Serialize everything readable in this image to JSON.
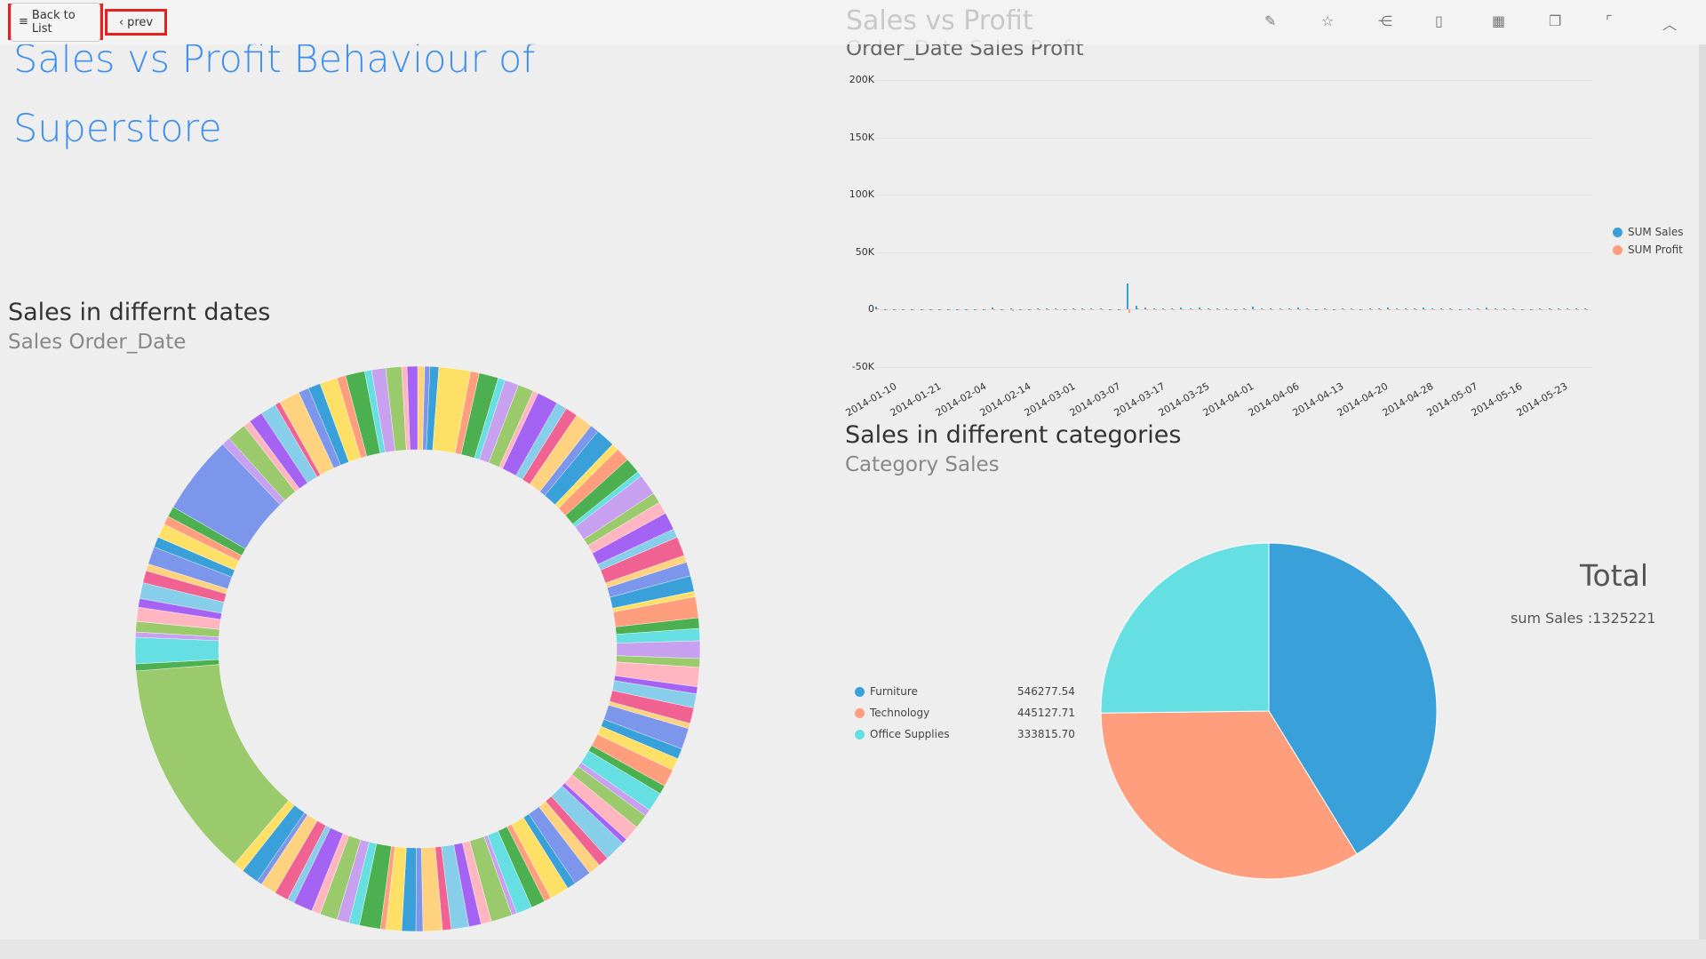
{
  "toolbar": {
    "back_label": "Back to List",
    "prev_label": "prev",
    "menu_icon": "list-icon",
    "prev_icon": "chevron-left-icon",
    "tools": [
      "edit-icon",
      "star-icon",
      "share-icon",
      "pdf-icon",
      "layout-filter-icon",
      "copy-icon",
      "fullscreen-icon",
      "chevron-up-icon"
    ]
  },
  "dashboard": {
    "title": "Sales vs Profit Behaviour of Superstore"
  },
  "colors": {
    "title": "#3d8fee",
    "sales": "#3aa0da",
    "profit": "#ff9e7d",
    "furniture": "#3aa0da",
    "technology": "#ff9e7d",
    "office": "#66dfe3"
  },
  "chart_data": [
    {
      "type": "bar",
      "title": "Sales vs Profit",
      "subtitle": "Order_Date Sales Profit",
      "yticks": [
        "200K",
        "150K",
        "100K",
        "50K",
        "0",
        "-50K"
      ],
      "ylim": [
        -50000,
        200000
      ],
      "xticks": [
        "2014-01-10",
        "2014-01-21",
        "2014-02-04",
        "2014-02-14",
        "2014-03-01",
        "2014-03-07",
        "2014-03-17",
        "2014-03-25",
        "2014-04-01",
        "2014-04-06",
        "2014-04-13",
        "2014-04-20",
        "2014-04-28",
        "2014-05-07",
        "2014-05-16",
        "2014-05-23"
      ],
      "legend": "right",
      "series": [
        {
          "name": "SUM Sales",
          "values": [
            2800,
            300,
            200,
            200,
            150,
            100,
            200,
            300,
            400,
            300,
            200,
            400,
            300,
            1500,
            200,
            700,
            300,
            200,
            1200,
            800,
            1100,
            600,
            800,
            900,
            1100,
            700,
            400,
            500,
            22500,
            3500,
            1500,
            1200,
            700,
            900,
            1500,
            1300,
            1800,
            700,
            1200,
            900,
            600,
            1000,
            2800,
            800,
            700,
            900,
            1300,
            1600,
            700,
            500,
            800,
            400,
            700,
            1300,
            600,
            900,
            1100,
            1800,
            1000,
            700,
            900,
            1500,
            1300,
            700,
            1000,
            600,
            800,
            1200,
            1700,
            900,
            700,
            1100,
            600,
            500,
            800,
            1300,
            700,
            900,
            1000,
            1200
          ]
        },
        {
          "name": "SUM Profit",
          "values": [
            900,
            50,
            20,
            30,
            10,
            20,
            30,
            40,
            60,
            50,
            20,
            80,
            60,
            300,
            30,
            -1200,
            40,
            30,
            200,
            150,
            180,
            100,
            120,
            140,
            160,
            90,
            60,
            80,
            -2500,
            1200,
            400,
            200,
            -600,
            150,
            300,
            250,
            -400,
            100,
            200,
            150,
            -300,
            180,
            500,
            120,
            100,
            150,
            220,
            300,
            100,
            80,
            120,
            60,
            100,
            250,
            90,
            150,
            200,
            300,
            180,
            100,
            150,
            250,
            220,
            100,
            160,
            90,
            130,
            200,
            300,
            150,
            100,
            180,
            90,
            80,
            130,
            220,
            100,
            150,
            170,
            200
          ]
        }
      ]
    },
    {
      "type": "pie",
      "subtype": "donut",
      "title": "Sales in differnt dates",
      "subtitle": "Sales Order_Date",
      "values": [
        0.4,
        0.3,
        0.5,
        1.8,
        0.5,
        1.1,
        0.4,
        0.8,
        0.9,
        0.3,
        1.2,
        0.6,
        0.7,
        1.0,
        0.5,
        1.1,
        0.4,
        0.8,
        0.9,
        0.3,
        1.2,
        0.6,
        0.7,
        1.0,
        0.5,
        1.1,
        0.4,
        0.8,
        0.9,
        0.3,
        1.2,
        0.6,
        0.7,
        1.0,
        0.5,
        1.1,
        0.4,
        0.8,
        0.9,
        0.3,
        1.2,
        0.6,
        0.7,
        1.0,
        0.5,
        1.1,
        0.4,
        0.8,
        0.9,
        0.3,
        1.2,
        0.6,
        0.7,
        1.0,
        0.5,
        1.1,
        0.4,
        0.8,
        0.9,
        0.3,
        1.2,
        0.6,
        0.7,
        1.0,
        0.5,
        1.1,
        0.4,
        0.8,
        0.9,
        0.3,
        1.2,
        0.6,
        0.7,
        1.0,
        0.5,
        1.1,
        0.4,
        0.8,
        0.9,
        0.3,
        1.0,
        0.6,
        12.5,
        0.4,
        1.5,
        0.3,
        0.6,
        0.8,
        0.5,
        0.9,
        0.7,
        0.4,
        1.0,
        0.6,
        0.8,
        0.5,
        0.6,
        4.5,
        0.5,
        1.1,
        0.4,
        0.8,
        0.9,
        0.3,
        1.2,
        0.6,
        0.7,
        1.0,
        0.5,
        1.1,
        0.4,
        0.8,
        0.9,
        0.3,
        0.6
      ]
    },
    {
      "type": "pie",
      "title": "Sales in different categories",
      "subtitle": "Category Sales",
      "categories": [
        "Furniture",
        "Technology",
        "Office Supplies"
      ],
      "values": [
        546277.54,
        445127.71,
        333815.7
      ],
      "labels": [
        "546277.54",
        "445127.71",
        "333815.70"
      ],
      "total": {
        "title": "Total",
        "text": "sum Sales :1325221"
      },
      "legend": "left"
    }
  ]
}
